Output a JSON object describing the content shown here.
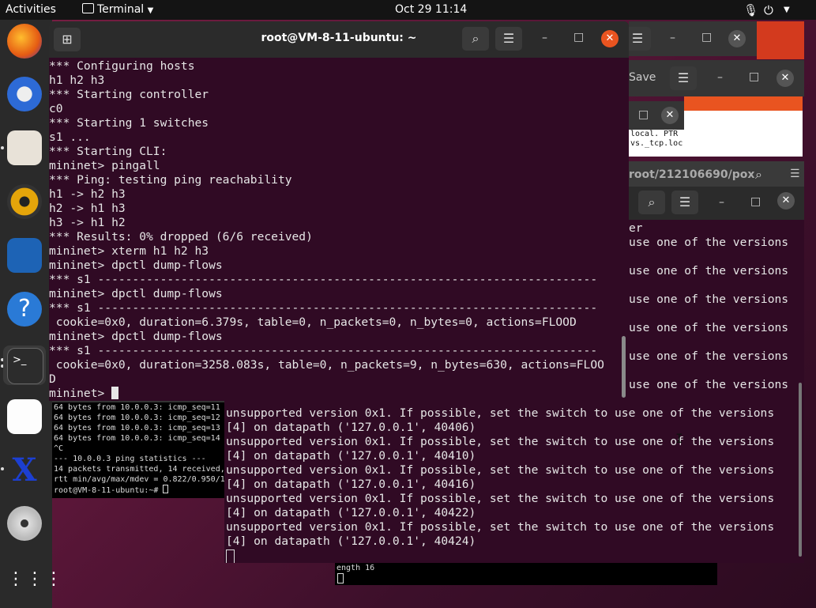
{
  "topbar": {
    "activities": "Activities",
    "app_menu": "Terminal",
    "datetime": "Oct 29  11:14"
  },
  "main_terminal": {
    "title": "root@VM-8-11-ubuntu: ~",
    "lines": [
      "*** Configuring hosts",
      "h1 h2 h3",
      "*** Starting controller",
      "c0",
      "*** Starting 1 switches",
      "s1 ...",
      "*** Starting CLI:",
      "mininet> pingall",
      "*** Ping: testing ping reachability",
      "h1 -> h2 h3",
      "h2 -> h1 h3",
      "h3 -> h1 h2",
      "*** Results: 0% dropped (6/6 received)",
      "mininet> xterm h1 h2 h3",
      "mininet> dpctl dump-flows",
      "*** s1 ------------------------------------------------------------------------",
      "mininet> dpctl dump-flows",
      "*** s1 ------------------------------------------------------------------------",
      " cookie=0x0, duration=6.379s, table=0, n_packets=0, n_bytes=0, actions=FLOOD",
      "mininet> dpctl dump-flows",
      "*** s1 ------------------------------------------------------------------------",
      " cookie=0x0, duration=3258.083s, table=0, n_packets=9, n_bytes=630, actions=FLOO",
      "D"
    ],
    "prompt": "mininet> "
  },
  "pox_terminal": {
    "title": "root/212106690/pox",
    "top_lines": [
      "er",
      "use one of the versions",
      "",
      "use one of the versions",
      "",
      "use one of the versions",
      "",
      "use one of the versions",
      "",
      "use one of the versions",
      "",
      "use one of the versions"
    ],
    "bottom_lines": [
      "unsupported version 0x1. If possible, set the switch to use one of the versions",
      "[4] on datapath ('127.0.0.1', 40406)",
      "unsupported version 0x1. If possible, set the switch to use one of the versions",
      "[4] on datapath ('127.0.0.1', 40410)",
      "unsupported version 0x1. If possible, set the switch to use one of the versions",
      "[4] on datapath ('127.0.0.1', 40416)",
      "unsupported version 0x1. If possible, set the switch to use one of the versions",
      "[4] on datapath ('127.0.0.1', 40422)",
      "unsupported version 0x1. If possible, set the switch to use one of the versions",
      "[4] on datapath ('127.0.0.1', 40424)"
    ]
  },
  "xterm": {
    "lines": [
      "64 bytes from 10.0.0.3: icmp_seq=11",
      "64 bytes from 10.0.0.3: icmp_seq=12",
      "64 bytes from 10.0.0.3: icmp_seq=13",
      "64 bytes from 10.0.0.3: icmp_seq=14",
      "^C",
      "--- 10.0.0.3 ping statistics ---",
      "14 packets transmitted, 14 received,",
      "rtt min/avg/max/mdev = 0.822/0.950/1",
      "root@VM-8-11-ubuntu:~# "
    ]
  },
  "small_xterm": {
    "line": "ength 16"
  },
  "back_editor": {
    "save_label": "Save"
  },
  "dialog": {
    "lines": [
      "local. PTR",
      "vs._tcp.loc"
    ]
  }
}
